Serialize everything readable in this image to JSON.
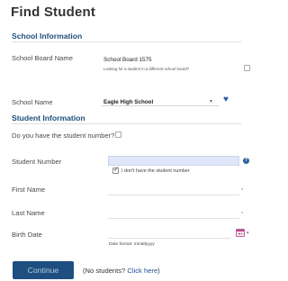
{
  "title": "Find Student",
  "school_section": {
    "header": "School Information",
    "board_label": "School Board Name",
    "board_value": "School Board 1575",
    "board_help_text": "Looking for a student in a different school board?",
    "school_label": "School Name",
    "school_value": "Eagle High School"
  },
  "student_section": {
    "header": "Student Information",
    "have_number_label": "Do you have the student number?",
    "student_number_label": "Student Number",
    "student_number_value": "",
    "no_number_label": "I don't have the student number",
    "first_name_label": "First Name",
    "last_name_label": "Last Name",
    "birth_date_label": "Birth Date",
    "birth_date_format": "Date format: mmddyyyy"
  },
  "footer": {
    "continue_label": "Continue",
    "no_students_text": "No students?",
    "click_here_label": "Click here"
  },
  "colors": {
    "accent": "#1d4e7d",
    "button": "#1e4f80",
    "input_highlight": "#dfe6f8",
    "link": "#1d4e9a"
  },
  "icons": [
    "heart-icon",
    "help-icon",
    "calendar-icon",
    "chevron-down-icon",
    "checkbox"
  ]
}
